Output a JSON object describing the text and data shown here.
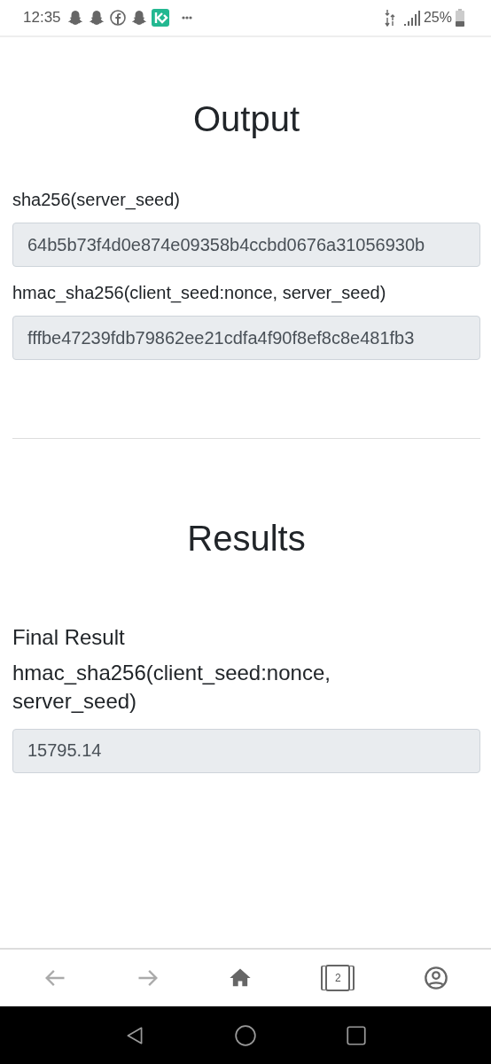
{
  "status_bar": {
    "time": "12:35",
    "notifications": [
      {
        "kind": "ghost"
      },
      {
        "kind": "ghost"
      },
      {
        "kind": "facebook"
      },
      {
        "kind": "ghost"
      },
      {
        "kind": "app"
      },
      {
        "kind": "more"
      }
    ],
    "battery": "25%"
  },
  "output": {
    "title": "Output",
    "fields": [
      {
        "label": "sha256(server_seed)",
        "value": "64b5b73f4d0e874e09358b4ccbd0676a31056930b"
      },
      {
        "label": "hmac_sha256(client_seed:nonce, server_seed)",
        "value": "fffbe47239fdb79862ee21cdfa4f90f8ef8c8e481fb3"
      }
    ]
  },
  "results": {
    "title": "Results",
    "subtitle": "Final Result",
    "label": "hmac_sha256(client_seed:nonce, server_seed)",
    "value": "15795.14"
  },
  "browser_nav": [
    {
      "kind": "back",
      "disabled": true
    },
    {
      "kind": "forward",
      "disabled": true
    },
    {
      "kind": "home",
      "disabled": false
    },
    {
      "kind": "tabs",
      "disabled": false,
      "count": "2"
    },
    {
      "kind": "account",
      "disabled": false
    }
  ],
  "system_nav": [
    {
      "kind": "back"
    },
    {
      "kind": "home"
    },
    {
      "kind": "recents"
    }
  ]
}
